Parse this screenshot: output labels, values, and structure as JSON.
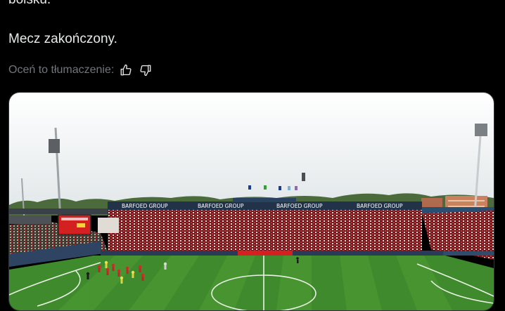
{
  "post": {
    "text_line_top": "boisku.",
    "text_line_end": "Mecz zakończony.",
    "translation_rating_label": "Oceń to tłumaczenie:"
  },
  "icons": {
    "thumb_up": "thumb-up-icon",
    "thumb_down": "thumb-down-icon"
  },
  "media": {
    "sponsor_banner": "BARFOED GROUP",
    "scoreboard": "",
    "colors": {
      "pitch": "#3f8a2c",
      "sky": "#f2f4f4",
      "stand_roof": "#223349",
      "crowd": "#a8262a",
      "scoreboard": "#d42020"
    }
  }
}
